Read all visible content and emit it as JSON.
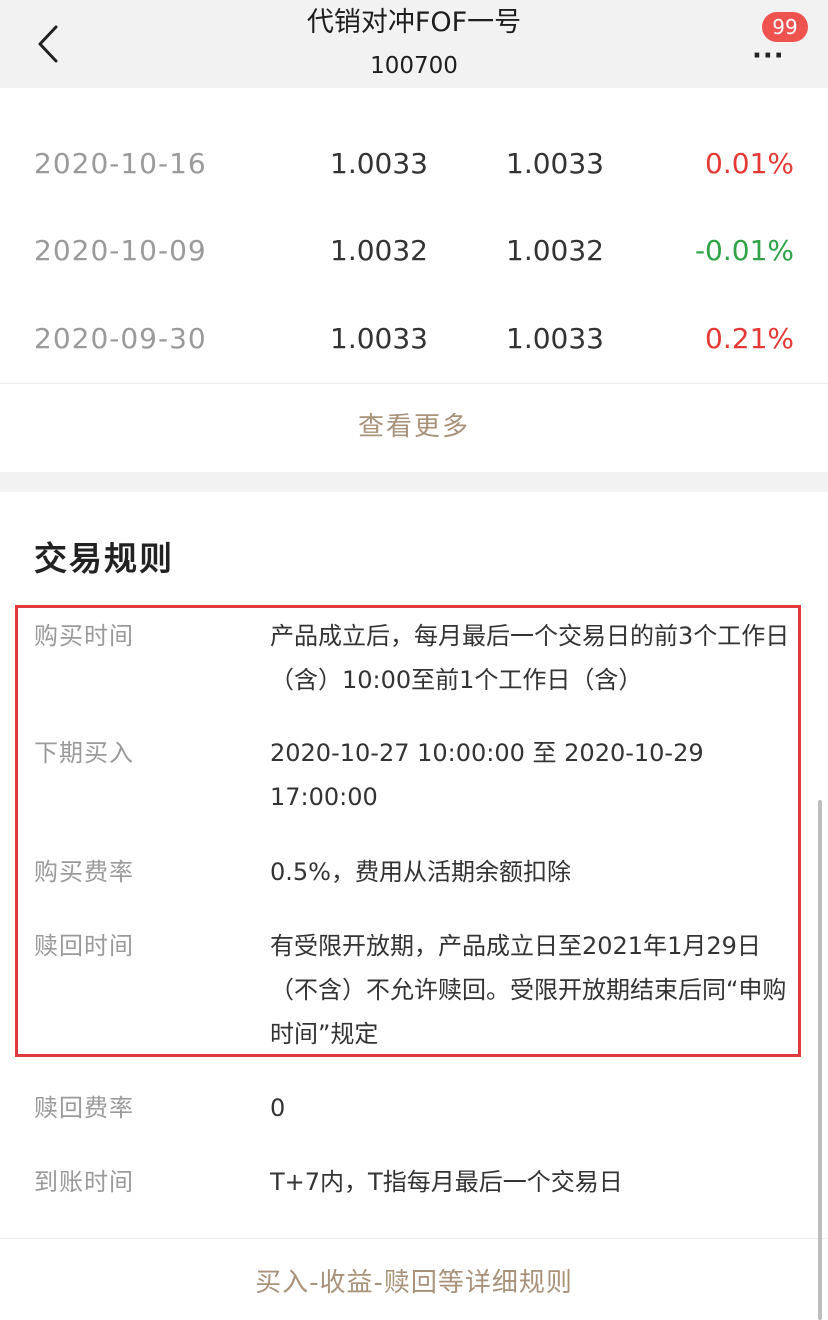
{
  "nav": {
    "title": "代销对冲FOF一号",
    "code": "100700",
    "badge": "99",
    "back_icon": "chevron-left-icon",
    "more_icon": "more-dots-icon"
  },
  "history": {
    "rows": [
      {
        "date": "2020-10-16",
        "nav": "1.0033",
        "acc_nav": "1.0033",
        "change": "0.01%",
        "trend": "up"
      },
      {
        "date": "2020-10-09",
        "nav": "1.0032",
        "acc_nav": "1.0032",
        "change": "-0.01%",
        "trend": "down"
      },
      {
        "date": "2020-09-30",
        "nav": "1.0033",
        "acc_nav": "1.0033",
        "change": "0.21%",
        "trend": "up"
      }
    ],
    "view_more": "查看更多"
  },
  "rules": {
    "title": "交易规则",
    "items": [
      {
        "label": "购买时间",
        "value": "产品成立后，每月最后一个交易日的前3个工作日（含）10:00至前1个工作日（含）"
      },
      {
        "label": "下期买入",
        "value": "2020-10-27 10:00:00 至 2020-10-29 17:00:00"
      },
      {
        "label": "购买费率",
        "value": "0.5%，费用从活期余额扣除"
      },
      {
        "label": "赎回时间",
        "value": "有受限开放期，产品成立日至2021年1月29日（不含）不允许赎回。受限开放期结束后同“申购时间”规定"
      },
      {
        "label": "赎回费率",
        "value": "0"
      },
      {
        "label": "到账时间",
        "value": "T+7内，T指每月最后一个交易日"
      }
    ],
    "detail_link": "买入-收益-赎回等详细规则"
  },
  "colors": {
    "up": "#e53935",
    "down": "#2fa347",
    "link": "#a89279",
    "highlight": "#e23a3a",
    "badge": "#ef5350"
  }
}
